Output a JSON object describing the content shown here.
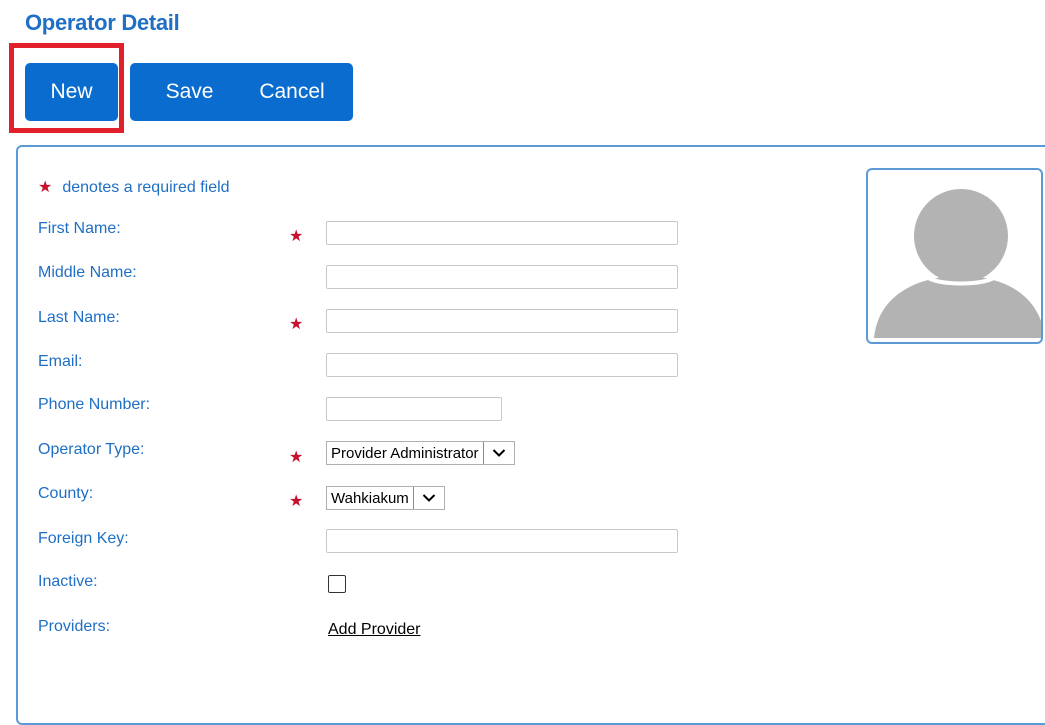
{
  "page": {
    "title": "Operator Detail"
  },
  "toolbar": {
    "new_label": "New",
    "save_label": "Save",
    "cancel_label": "Cancel"
  },
  "form": {
    "required_note": "denotes a required field",
    "fields": {
      "first_name": {
        "label": "First Name:",
        "value": "",
        "required": true
      },
      "middle_name": {
        "label": "Middle Name:",
        "value": "",
        "required": false
      },
      "last_name": {
        "label": "Last Name:",
        "value": "",
        "required": true
      },
      "email": {
        "label": "Email:",
        "value": "",
        "required": false
      },
      "phone_number": {
        "label": "Phone Number:",
        "value": "",
        "required": false
      },
      "operator_type": {
        "label": "Operator Type:",
        "value": "Provider Administrator",
        "required": true
      },
      "county": {
        "label": "County:",
        "value": "Wahkiakum",
        "required": true
      },
      "foreign_key": {
        "label": "Foreign Key:",
        "value": "",
        "required": false
      },
      "inactive": {
        "label": "Inactive:",
        "checked": false
      },
      "providers": {
        "label": "Providers:",
        "link_label": "Add Provider"
      }
    }
  },
  "colors": {
    "accent_blue": "#1f6fc5",
    "button_blue": "#0a6ccf",
    "required_red": "#c8102e",
    "highlight_red": "#e0202a",
    "panel_border": "#5b9bd5",
    "avatar_gray": "#b3b3b3"
  },
  "icons": {
    "avatar": "user-silhouette-icon",
    "dropdown": "chevron-down-icon",
    "required": "star-icon"
  }
}
